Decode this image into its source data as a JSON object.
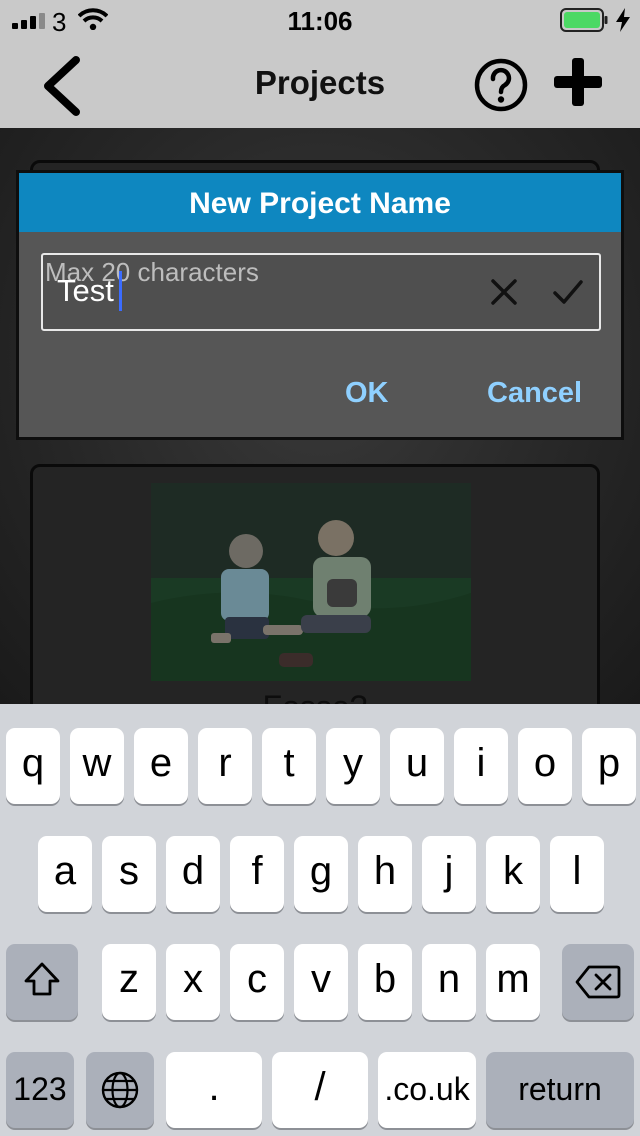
{
  "status_bar": {
    "carrier": "3",
    "time": "11:06",
    "battery_color": "#4cd964"
  },
  "nav": {
    "title": "Projects",
    "back_icon": "chevron-left-icon",
    "help_icon": "help-circle-icon",
    "add_icon": "plus-icon"
  },
  "background_card": {
    "title": "Fosse?"
  },
  "dialog": {
    "title": "New Project Name",
    "header_color": "#0e87c0",
    "input": {
      "placeholder": "Max 20 characters",
      "value": "Test"
    },
    "ok_label": "OK",
    "cancel_label": "Cancel",
    "action_color": "#8fd0ff"
  },
  "keyboard": {
    "row1": [
      "q",
      "w",
      "e",
      "r",
      "t",
      "y",
      "u",
      "i",
      "o",
      "p"
    ],
    "row2": [
      "a",
      "s",
      "d",
      "f",
      "g",
      "h",
      "j",
      "k",
      "l"
    ],
    "row3": [
      "z",
      "x",
      "c",
      "v",
      "b",
      "n",
      "m"
    ],
    "numbers_label": "123",
    "period_label": ".",
    "slash_label": "/",
    "domain_label": ".co.uk",
    "return_label": "return"
  }
}
